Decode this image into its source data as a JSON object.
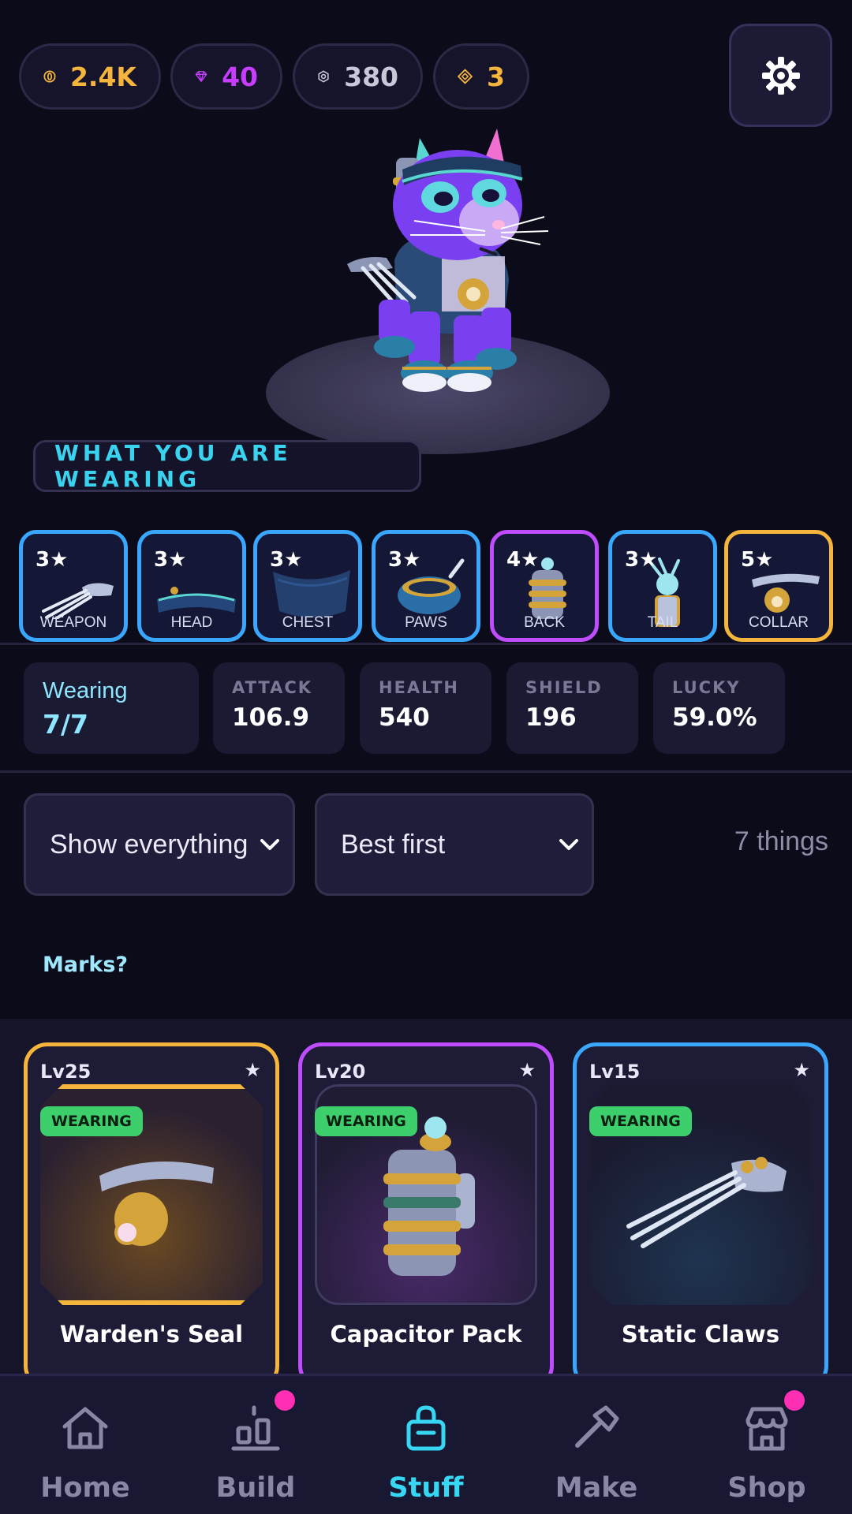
{
  "currencies": [
    {
      "name": "coins",
      "value": "2.4K",
      "color": "#f5b43c",
      "icon": "coin-icon"
    },
    {
      "name": "gems",
      "value": "40",
      "color": "#c83cff",
      "icon": "gem-icon"
    },
    {
      "name": "bolts",
      "value": "380",
      "color": "#c9c8d9",
      "icon": "hex-nut-icon"
    },
    {
      "name": "tokens",
      "value": "3",
      "color": "#f5b43c",
      "icon": "diamond-token-icon"
    }
  ],
  "settings": {
    "icon": "gear-icon"
  },
  "wearing_title": "WHAT YOU ARE WEARING",
  "slots": [
    {
      "stars": "3★",
      "label": "WEAPON",
      "border": "#3aa7ff"
    },
    {
      "stars": "3★",
      "label": "HEAD",
      "border": "#3aa7ff"
    },
    {
      "stars": "3★",
      "label": "CHEST",
      "border": "#3aa7ff"
    },
    {
      "stars": "3★",
      "label": "PAWS",
      "border": "#3aa7ff"
    },
    {
      "stars": "4★",
      "label": "BACK",
      "border": "#c04cff"
    },
    {
      "stars": "3★",
      "label": "TAIL",
      "border": "#3aa7ff"
    },
    {
      "stars": "5★",
      "label": "COLLAR",
      "border": "#f5b43c"
    }
  ],
  "wearing_summary": {
    "label": "Wearing",
    "value": "7/7"
  },
  "stats": [
    {
      "key": "ATTACK",
      "value": "106.9"
    },
    {
      "key": "HEALTH",
      "value": "540"
    },
    {
      "key": "SHIELD",
      "value": "196"
    },
    {
      "key": "LUCKY",
      "value": "59.0%"
    }
  ],
  "filters": {
    "show": "Show everything",
    "sort": "Best first",
    "count": "7 things"
  },
  "marks_link": "Marks?",
  "cards": [
    {
      "level": "Lv25",
      "badge": "WEARING",
      "name": "Warden's Seal",
      "border": "#f5b43c"
    },
    {
      "level": "Lv20",
      "badge": "WEARING",
      "name": "Capacitor Pack",
      "border": "#c04cff"
    },
    {
      "level": "Lv15",
      "badge": "WEARING",
      "name": "Static Claws",
      "border": "#3aa7ff"
    }
  ],
  "nav": [
    {
      "label": "Home",
      "icon": "house-icon",
      "active": false,
      "dot": false
    },
    {
      "label": "Build",
      "icon": "build-icon",
      "active": false,
      "dot": true
    },
    {
      "label": "Stuff",
      "icon": "bag-icon",
      "active": true,
      "dot": false
    },
    {
      "label": "Make",
      "icon": "hammer-icon",
      "active": false,
      "dot": false
    },
    {
      "label": "Shop",
      "icon": "shop-icon",
      "active": false,
      "dot": true
    }
  ]
}
